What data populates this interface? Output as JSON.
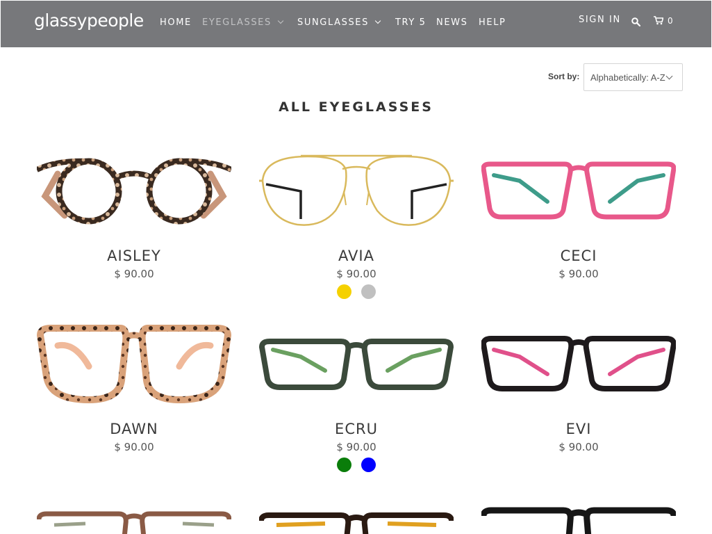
{
  "header": {
    "logo": "glassypeople",
    "nav": [
      {
        "label": "HOME",
        "dropdown": false,
        "active": false
      },
      {
        "label": "EYEGLASSES",
        "dropdown": true,
        "active": true
      },
      {
        "label": "SUNGLASSES",
        "dropdown": true,
        "active": false
      },
      {
        "label": "TRY 5",
        "dropdown": false,
        "active": false
      },
      {
        "label": "NEWS",
        "dropdown": false,
        "active": false
      },
      {
        "label": "HELP",
        "dropdown": false,
        "active": false
      }
    ],
    "sign_in": "SIGN IN",
    "search_icon": "search-icon",
    "cart_icon": "cart-icon",
    "cart_count": "0",
    "colors": {
      "bar": "#77787b",
      "text": "#ffffff",
      "active_text": "#c2c3c5"
    }
  },
  "sort": {
    "label": "Sort by:",
    "selected": "Alphabetically: A-Z"
  },
  "page_title": "ALL EYEGLASSES",
  "products": [
    {
      "name": "AISLEY",
      "price": "$ 90.00",
      "swatches": []
    },
    {
      "name": "AVIA",
      "price": "$ 90.00",
      "swatches": [
        "#f5d100",
        "#c0c0c0"
      ]
    },
    {
      "name": "CECI",
      "price": "$ 90.00",
      "swatches": []
    },
    {
      "name": "DAWN",
      "price": "$ 90.00",
      "swatches": []
    },
    {
      "name": "ECRU",
      "price": "$ 90.00",
      "swatches": [
        "#0a7d0a",
        "#0000ff"
      ]
    },
    {
      "name": "EVI",
      "price": "$ 90.00",
      "swatches": []
    }
  ]
}
